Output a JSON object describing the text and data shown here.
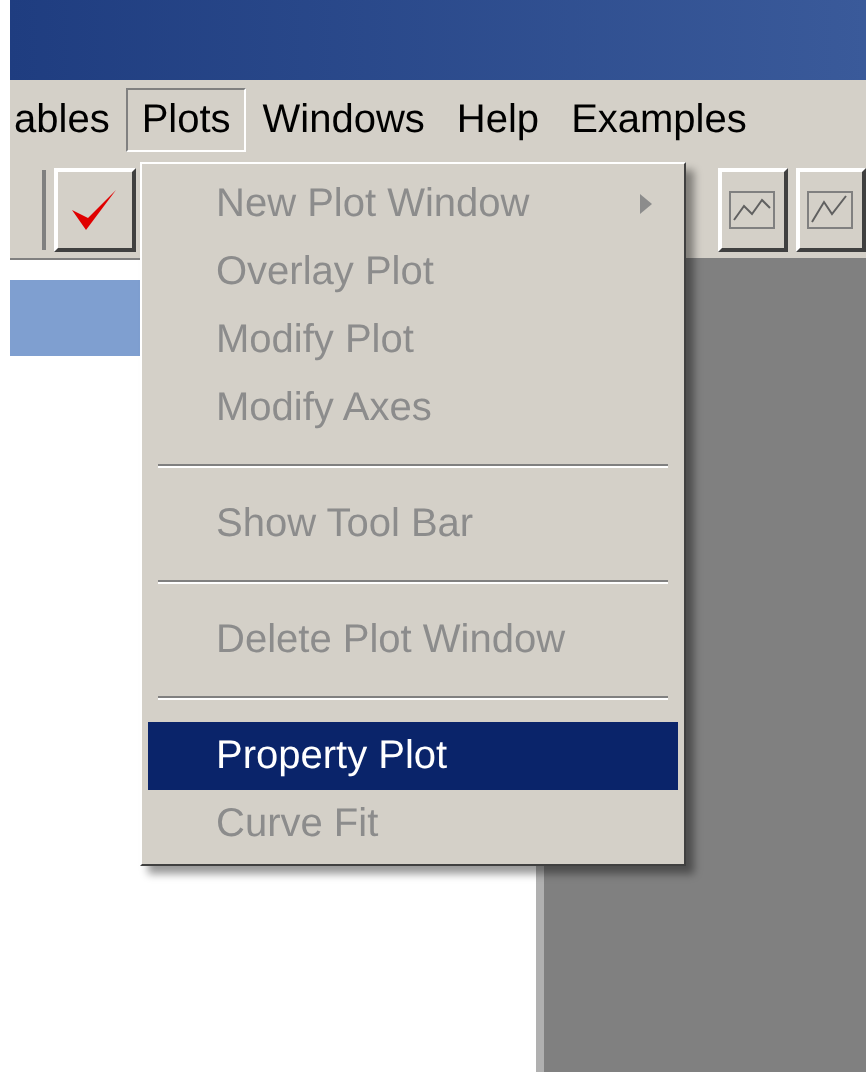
{
  "menu_bar": [
    {
      "label": "ables",
      "selected": false
    },
    {
      "label": "Plots",
      "selected": true
    },
    {
      "label": "Windows",
      "selected": false
    },
    {
      "label": "Help",
      "selected": false
    },
    {
      "label": "Examples",
      "selected": false
    }
  ],
  "plots_menu": [
    {
      "kind": "item",
      "label": "New Plot Window",
      "disabled": true,
      "submenu": true,
      "selected": false
    },
    {
      "kind": "item",
      "label": "Overlay Plot",
      "disabled": true,
      "submenu": false,
      "selected": false
    },
    {
      "kind": "item",
      "label": "Modify Plot",
      "disabled": true,
      "submenu": false,
      "selected": false
    },
    {
      "kind": "item",
      "label": "Modify Axes",
      "disabled": true,
      "submenu": false,
      "selected": false
    },
    {
      "kind": "separator"
    },
    {
      "kind": "item",
      "label": "Show Tool Bar",
      "disabled": true,
      "submenu": false,
      "selected": false
    },
    {
      "kind": "separator"
    },
    {
      "kind": "item",
      "label": "Delete Plot Window",
      "disabled": true,
      "submenu": false,
      "selected": false
    },
    {
      "kind": "separator"
    },
    {
      "kind": "item",
      "label": "Property Plot",
      "disabled": false,
      "submenu": false,
      "selected": true
    },
    {
      "kind": "item",
      "label": "Curve Fit",
      "disabled": true,
      "submenu": false,
      "selected": false
    }
  ]
}
